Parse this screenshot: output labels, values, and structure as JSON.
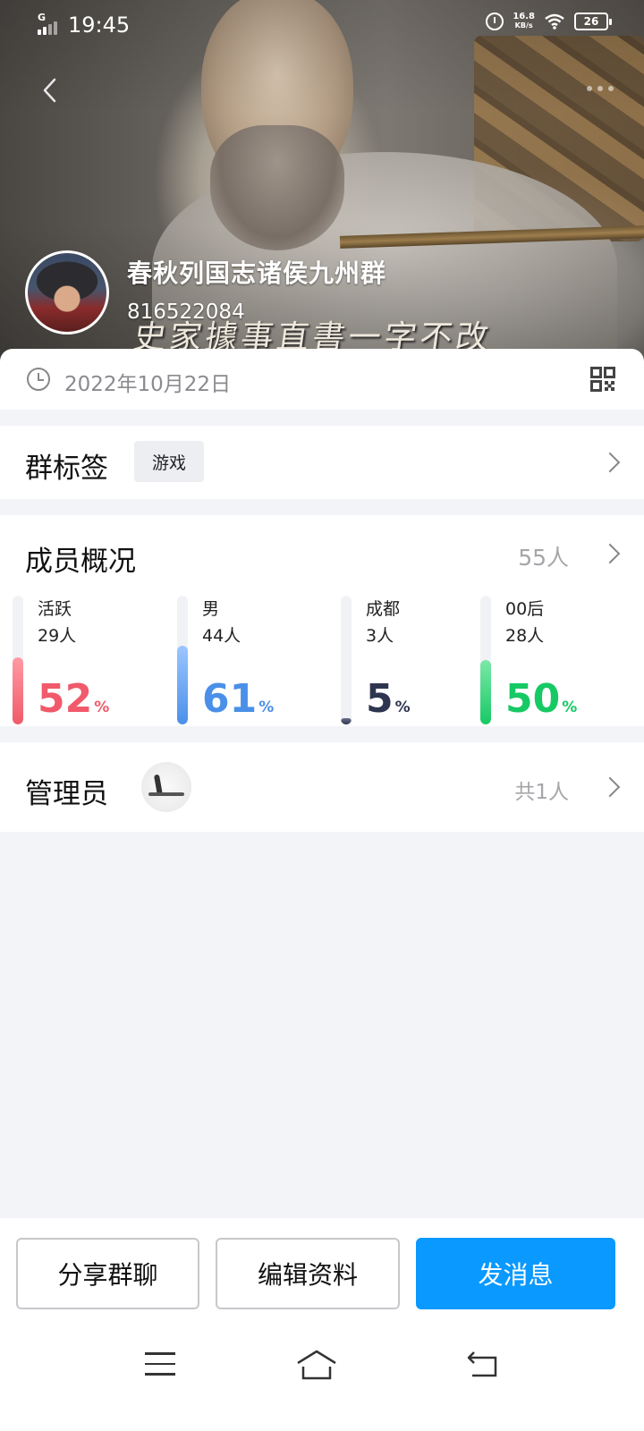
{
  "status_bar": {
    "network": "G",
    "time": "19:45",
    "speed_value": "16.8",
    "speed_unit": "KB/s",
    "battery": "26"
  },
  "header": {
    "group_name": "春秋列国志诸侯九州群",
    "group_id": "816522084",
    "subtitle_text": "史家據事直書一字不改"
  },
  "info": {
    "date": "2022年10月22日"
  },
  "tags": {
    "title": "群标签",
    "items": [
      "游戏"
    ]
  },
  "members": {
    "title": "成员概况",
    "total": "55人",
    "stats": [
      {
        "label": "活跃",
        "count": "29人",
        "percent": 52,
        "percent_text": "52",
        "color": "#f05a6a",
        "fill_top": "#ff9aa4"
      },
      {
        "label": "男",
        "count": "44人",
        "percent": 61,
        "percent_text": "61",
        "color": "#4a90e8",
        "fill_top": "#9cc6ff"
      },
      {
        "label": "成都",
        "count": "3人",
        "percent": 5,
        "percent_text": "5",
        "color": "#2e3550",
        "fill_top": "#6a708a"
      },
      {
        "label": "00后",
        "count": "28人",
        "percent": 50,
        "percent_text": "50",
        "color": "#17c964",
        "fill_top": "#7be8a8"
      }
    ],
    "percent_sign": "%"
  },
  "admins": {
    "title": "管理员",
    "count": "共1人"
  },
  "actions": {
    "share": "分享群聊",
    "edit": "编辑资料",
    "send": "发消息"
  },
  "colors": {
    "primary": "#0a99ff",
    "page_bg": "#f3f4f8"
  }
}
